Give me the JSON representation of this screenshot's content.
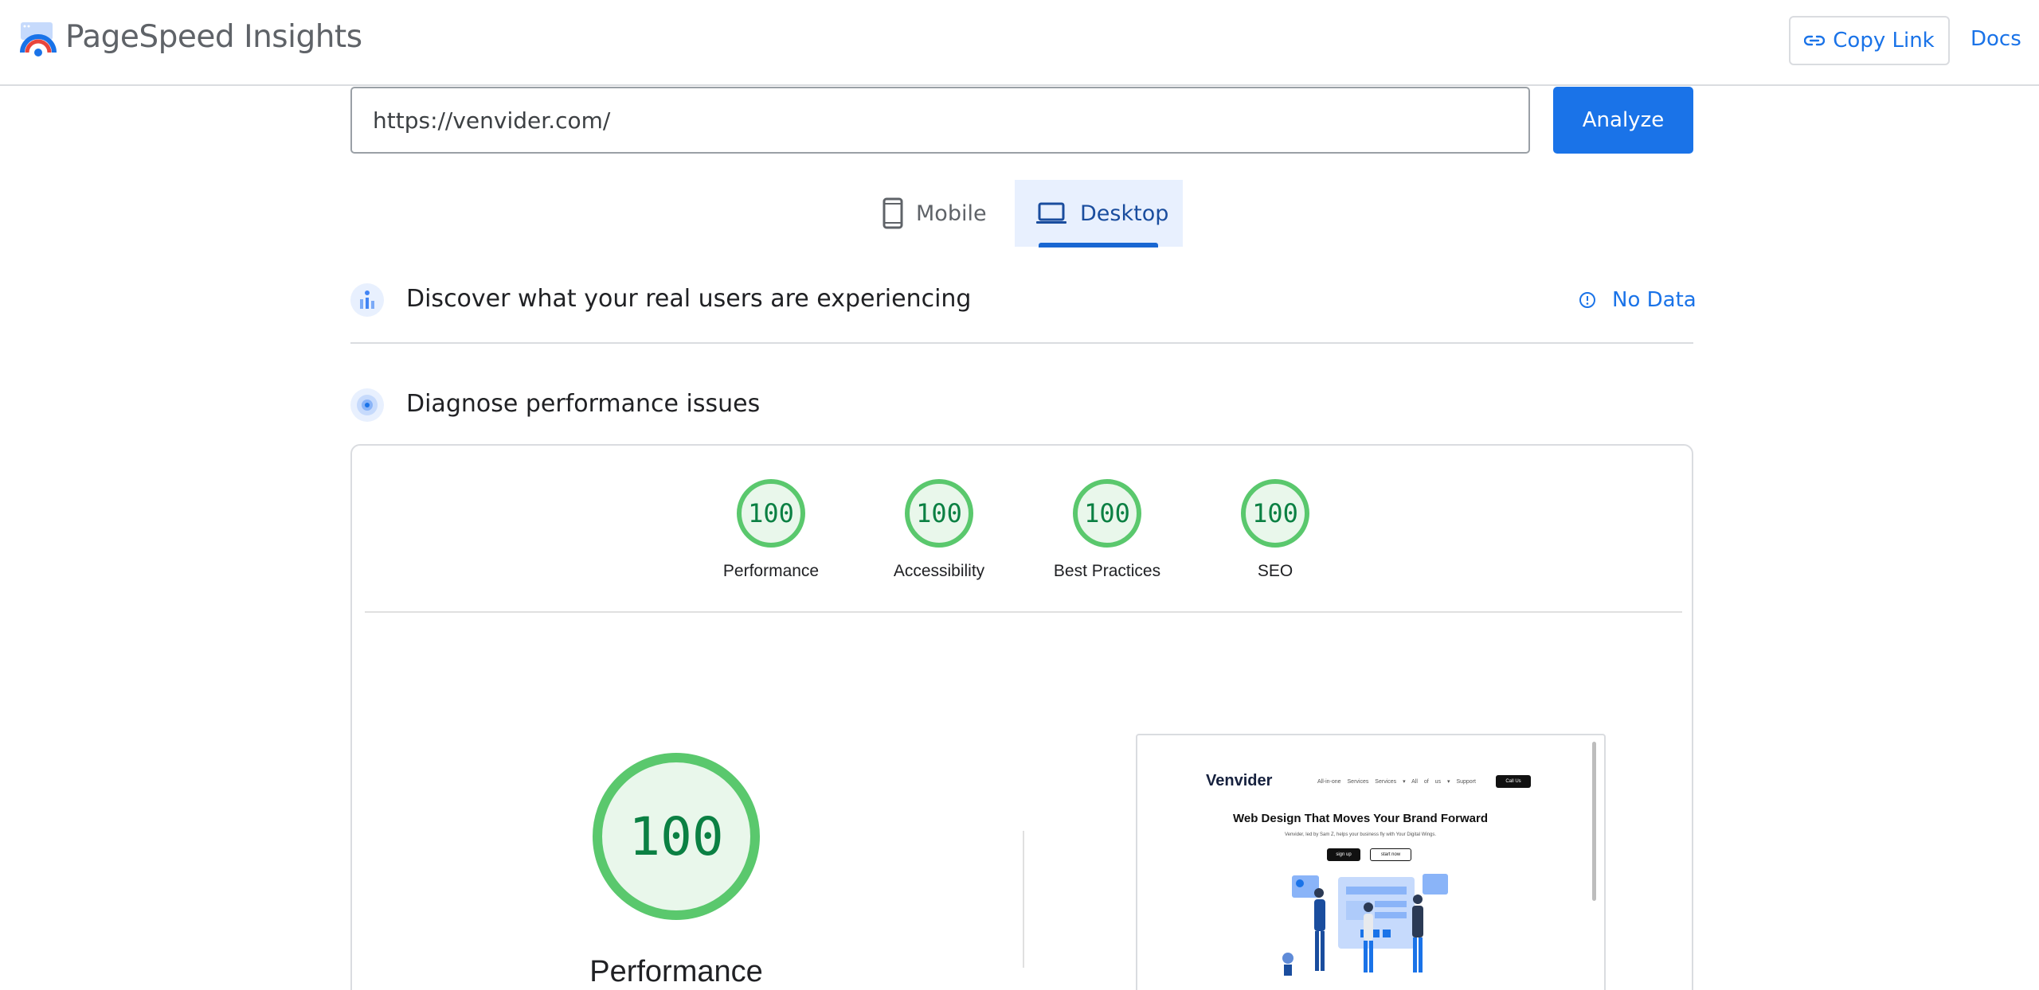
{
  "header": {
    "title": "PageSpeed Insights",
    "copy_link": "Copy Link",
    "docs": "Docs"
  },
  "search": {
    "url": "https://venvider.com/",
    "analyze": "Analyze"
  },
  "tabs": {
    "mobile": "Mobile",
    "desktop": "Desktop",
    "selected": "desktop"
  },
  "field_data": {
    "title": "Discover what your real users are experiencing",
    "status": "No Data"
  },
  "lab_data": {
    "title": "Diagnose performance issues"
  },
  "scores": [
    {
      "label": "Performance",
      "value": "100"
    },
    {
      "label": "Accessibility",
      "value": "100"
    },
    {
      "label": "Best Practices",
      "value": "100"
    },
    {
      "label": "SEO",
      "value": "100"
    }
  ],
  "main_score": {
    "value": "100",
    "label": "Performance"
  },
  "screenshot": {
    "brand": "Venvider",
    "nav": "All-in-one Services  Services ▾  All of us ▾  Support",
    "cta": "Call Us",
    "headline": "Web Design That Moves Your Brand Forward",
    "subline": "Venvider, led by Sam Z, helps your business fly with Your Digital Wings.",
    "btn_primary": "sign up",
    "btn_secondary": "start now"
  },
  "colors": {
    "accent": "#1a73e8",
    "pass": "#5ac86d",
    "pass_text": "#0b8043"
  }
}
